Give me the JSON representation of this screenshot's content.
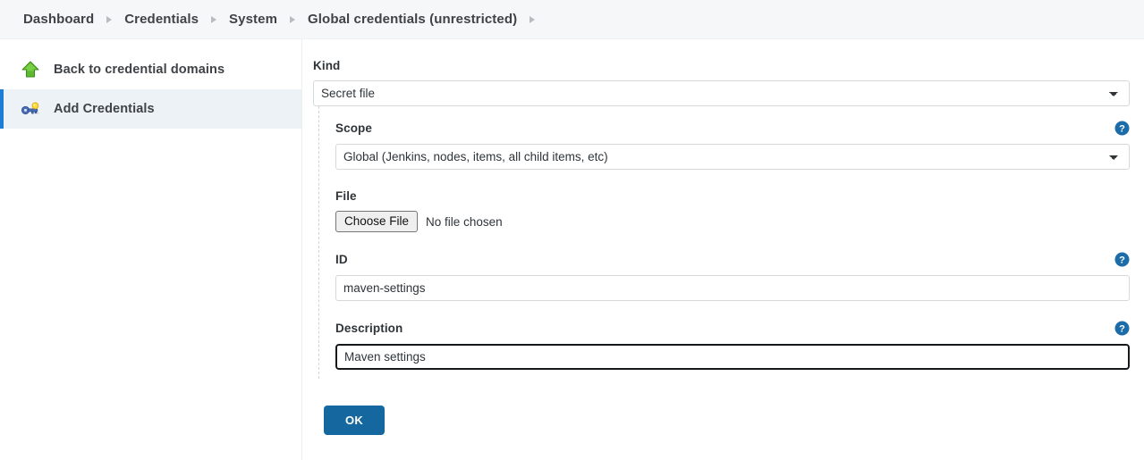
{
  "breadcrumb": {
    "items": [
      {
        "label": "Dashboard",
        "name": "breadcrumb-dashboard"
      },
      {
        "label": "Credentials",
        "name": "breadcrumb-credentials"
      },
      {
        "label": "System",
        "name": "breadcrumb-system"
      },
      {
        "label": "Global credentials (unrestricted)",
        "name": "breadcrumb-global-credentials"
      }
    ],
    "separator_icon": "chevron-right-icon"
  },
  "sidebar": {
    "items": [
      {
        "label": "Back to credential domains",
        "icon": "green-up-arrow-icon",
        "selected": false
      },
      {
        "label": "Add Credentials",
        "icon": "key-icon",
        "selected": true
      }
    ]
  },
  "form": {
    "kind": {
      "label": "Kind",
      "value": "Secret file",
      "options": [
        "Secret file"
      ]
    },
    "scope": {
      "label": "Scope",
      "value": "Global (Jenkins, nodes, items, all child items, etc)",
      "options": [
        "Global (Jenkins, nodes, items, all child items, etc)"
      ],
      "help_icon": "help-icon"
    },
    "file": {
      "label": "File",
      "button_label": "Choose File",
      "status_text": "No file chosen"
    },
    "id": {
      "label": "ID",
      "value": "maven-settings",
      "placeholder": "",
      "help_icon": "help-icon"
    },
    "description": {
      "label": "Description",
      "value": "Maven settings",
      "placeholder": "",
      "help_icon": "help-icon",
      "focused": true
    },
    "submit": {
      "label": "OK"
    }
  },
  "colors": {
    "accent_blue": "#15679f",
    "selected_item_bg": "#edf2f6",
    "selected_item_border": "#1c7cd6",
    "help_blue": "#1b6ca8",
    "breadcrumb_bg": "#f6f7f8"
  }
}
